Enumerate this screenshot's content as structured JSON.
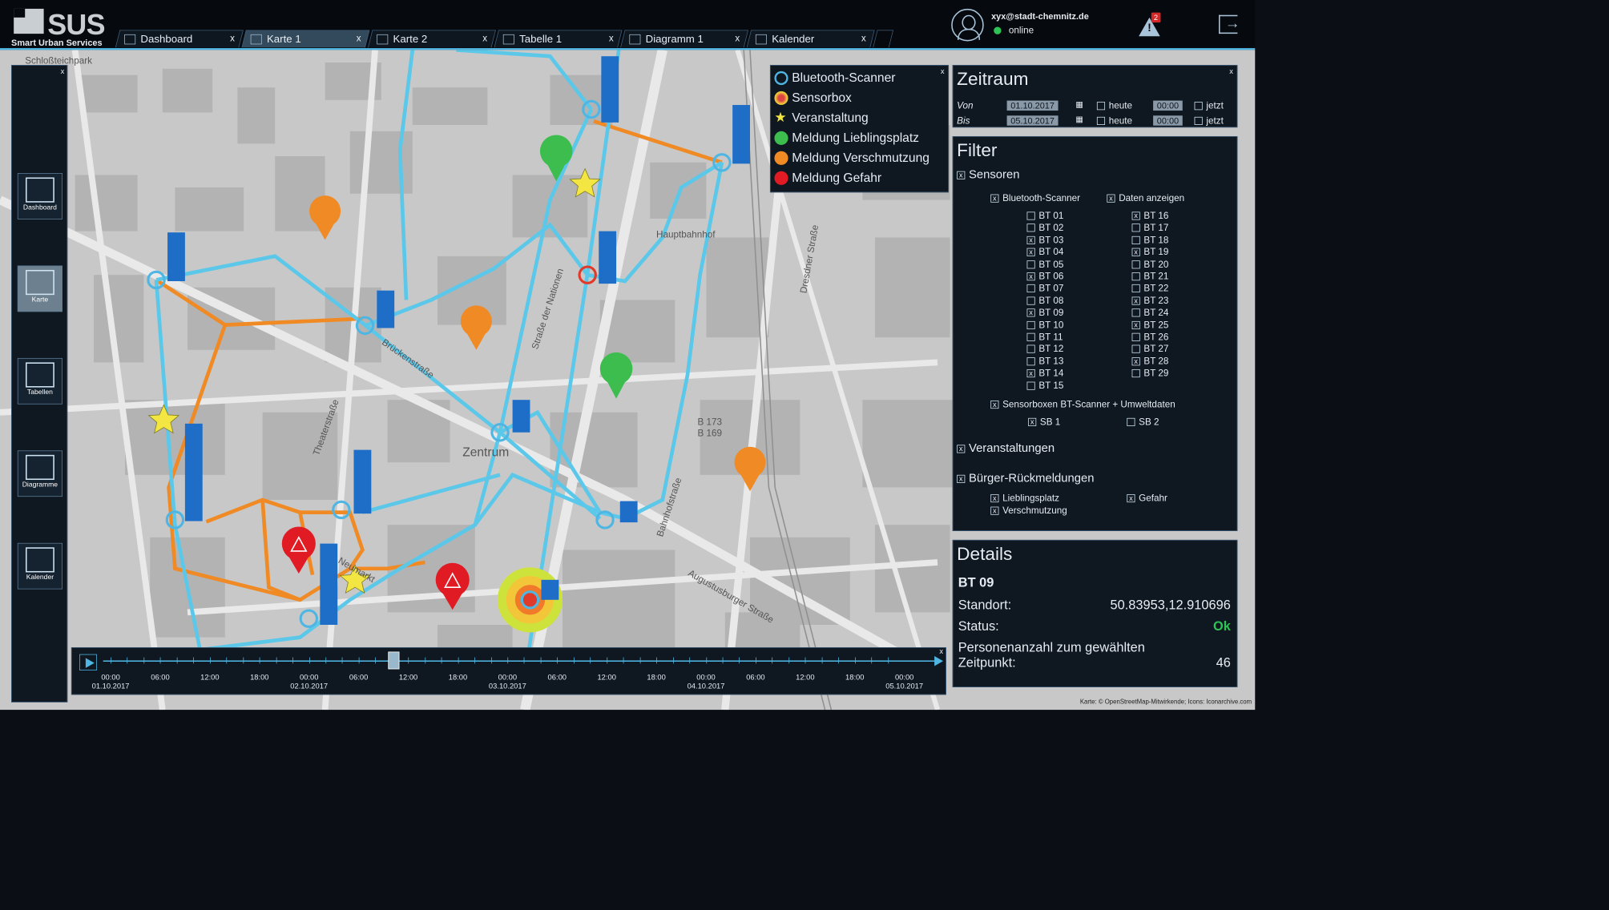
{
  "app": {
    "logo_word": "SUS",
    "logo_sub": "Smart Urban Services"
  },
  "tabs": [
    {
      "label": "Dashboard",
      "icon": "dashboard-icon"
    },
    {
      "label": "Karte 1",
      "icon": "map-icon"
    },
    {
      "label": "Karte 2",
      "icon": "map-icon"
    },
    {
      "label": "Tabelle 1",
      "icon": "table-icon"
    },
    {
      "label": "Diagramm 1",
      "icon": "chart-icon"
    },
    {
      "label": "Kalender",
      "icon": "calendar-icon"
    }
  ],
  "user": {
    "email": "xyx@stadt-chemnitz.de",
    "status": "online"
  },
  "alerts": {
    "count": "2"
  },
  "sidebar": {
    "items": [
      {
        "label": "Dashboard",
        "icon": "dashboard-icon"
      },
      {
        "label": "Karte",
        "icon": "map-icon"
      },
      {
        "label": "Tabellen",
        "icon": "table-icon"
      },
      {
        "label": "Diagramme",
        "icon": "chart-icon"
      },
      {
        "label": "Kalender",
        "icon": "calendar-icon"
      }
    ]
  },
  "legend": {
    "items": [
      {
        "label": "Bluetooth-Scanner",
        "color": "#4fb6e3"
      },
      {
        "label": "Sensorbox",
        "color": "#d44"
      },
      {
        "label": "Veranstaltung",
        "color": "#f3e642"
      },
      {
        "label": "Meldung Lieblingsplatz",
        "color": "#3cbd4e"
      },
      {
        "label": "Meldung Verschmutzung",
        "color": "#f08a24"
      },
      {
        "label": "Meldung Gefahr",
        "color": "#e01b24"
      }
    ]
  },
  "zeitraum": {
    "title": "Zeitraum",
    "von_label": "Von",
    "von_date": "01.10.2017",
    "von_time": "00:00",
    "bis_label": "Bis",
    "bis_date": "05.10.2017",
    "bis_time": "00:00",
    "heute": "heute",
    "jetzt": "jetzt"
  },
  "filter": {
    "title": "Filter",
    "sensoren": "Sensoren",
    "bt_scanner": "Bluetooth-Scanner",
    "daten": "Daten anzeigen",
    "bt_left": [
      {
        "l": "BT 01",
        "c": false
      },
      {
        "l": "BT 02",
        "c": false
      },
      {
        "l": "BT 03",
        "c": true
      },
      {
        "l": "BT 04",
        "c": true
      },
      {
        "l": "BT 05",
        "c": false
      },
      {
        "l": "BT 06",
        "c": true
      },
      {
        "l": "BT 07",
        "c": false
      },
      {
        "l": "BT 08",
        "c": false
      },
      {
        "l": "BT 09",
        "c": true
      },
      {
        "l": "BT 10",
        "c": false
      },
      {
        "l": "BT 11",
        "c": false
      },
      {
        "l": "BT 12",
        "c": false
      },
      {
        "l": "BT 13",
        "c": false
      },
      {
        "l": "BT 14",
        "c": true
      },
      {
        "l": "BT 15",
        "c": false
      }
    ],
    "bt_right": [
      {
        "l": "BT 16",
        "c": true
      },
      {
        "l": "BT 17",
        "c": false
      },
      {
        "l": "BT 18",
        "c": false
      },
      {
        "l": "BT 19",
        "c": true
      },
      {
        "l": "BT 20",
        "c": false
      },
      {
        "l": "BT 21",
        "c": false
      },
      {
        "l": "BT 22",
        "c": false
      },
      {
        "l": "BT 23",
        "c": true
      },
      {
        "l": "BT 24",
        "c": false
      },
      {
        "l": "BT 25",
        "c": true
      },
      {
        "l": "BT 26",
        "c": false
      },
      {
        "l": "BT 27",
        "c": false
      },
      {
        "l": "BT 28",
        "c": true
      },
      {
        "l": "BT 29",
        "c": false
      }
    ],
    "sensorboxen": "Sensorboxen BT-Scanner + Umweltdaten",
    "sb1": "SB 1",
    "sb2": "SB 2",
    "veranstaltungen": "Veranstaltungen",
    "buerger": "Bürger-Rückmeldungen",
    "lieblingsplatz": "Lieblingsplatz",
    "gefahr": "Gefahr",
    "verschmutzung": "Verschmutzung"
  },
  "details": {
    "title": "Details",
    "id": "BT 09",
    "standort_label": "Standort:",
    "standort": "50.83953,12.910696",
    "status_label": "Status:",
    "status": "Ok",
    "personen_label": "Personenanzahl zum gewählten Zeitpunkt:",
    "personen": "46"
  },
  "timeline": {
    "labels": [
      {
        "t": "00:00",
        "d": "01.10.2017"
      },
      {
        "t": "06:00",
        "d": ""
      },
      {
        "t": "12:00",
        "d": ""
      },
      {
        "t": "18:00",
        "d": ""
      },
      {
        "t": "00:00",
        "d": "02.10.2017"
      },
      {
        "t": "06:00",
        "d": ""
      },
      {
        "t": "12:00",
        "d": ""
      },
      {
        "t": "18:00",
        "d": ""
      },
      {
        "t": "00:00",
        "d": "03.10.2017"
      },
      {
        "t": "06:00",
        "d": ""
      },
      {
        "t": "12:00",
        "d": ""
      },
      {
        "t": "18:00",
        "d": ""
      },
      {
        "t": "00:00",
        "d": "04.10.2017"
      },
      {
        "t": "06:00",
        "d": ""
      },
      {
        "t": "12:00",
        "d": ""
      },
      {
        "t": "18:00",
        "d": ""
      },
      {
        "t": "00:00",
        "d": "05.10.2017"
      }
    ]
  },
  "map_labels": [
    "Schloßteichpark",
    "Theaterstraße",
    "Brückenstraße",
    "Zentrum",
    "Bahnhofstraße",
    "Straße der Nationen",
    "Hauptbahnhof",
    "Dresdner Straße",
    "Augustusburger Straße",
    "Neumarkt",
    "B 173",
    "B 169"
  ],
  "credit": "Karte: © OpenStreetMap-Mitwirkende; Icons: Iconarchive.com"
}
